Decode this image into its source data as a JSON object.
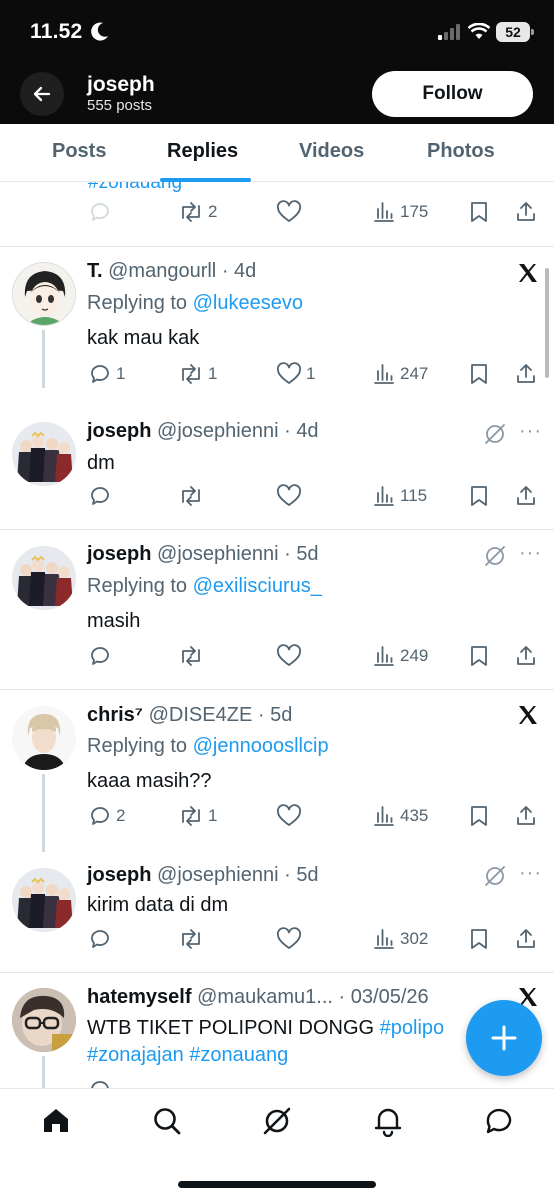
{
  "status_bar": {
    "time": "11.52",
    "battery": "52"
  },
  "profile": {
    "name": "joseph",
    "posts": "555 posts",
    "follow_label": "Follow"
  },
  "tabs": [
    {
      "label": "Posts"
    },
    {
      "label": "Replies"
    },
    {
      "label": "Videos"
    },
    {
      "label": "Photos"
    }
  ],
  "partial_post": {
    "hashtag": "#zonauang",
    "retweets": "2",
    "views": "175"
  },
  "posts": [
    {
      "name": "T.",
      "handle": "@mangourll",
      "time": "4d",
      "replying_prefix": "Replying to",
      "replying_to": "@lukeesevo",
      "text": "kak mau kak",
      "replies": "1",
      "retweets": "1",
      "likes": "1",
      "views": "247",
      "badge": "x-icon"
    },
    {
      "name": "joseph",
      "handle": "@josephienni",
      "time": "4d",
      "text": "dm",
      "views": "115",
      "badge": "grok-icon"
    },
    {
      "name": "joseph",
      "handle": "@josephienni",
      "time": "5d",
      "replying_prefix": "Replying to",
      "replying_to": "@exilisciurus_",
      "text": "masih",
      "views": "249",
      "badge": "grok-icon"
    },
    {
      "name": "chris⁷",
      "handle": "@DISE4ZE",
      "time": "5d",
      "replying_prefix": "Replying to",
      "replying_to": "@jennooosllcip",
      "text": "kaaa masih??",
      "replies": "2",
      "retweets": "1",
      "views": "435",
      "badge": "x-icon"
    },
    {
      "name": "joseph",
      "handle": "@josephienni",
      "time": "5d",
      "text": "kirim data di dm",
      "views": "302",
      "badge": "grok-icon"
    },
    {
      "name": "hatemyself",
      "handle": "@maukamu1...",
      "time": "03/05/26",
      "text": "WTB TIKET POLIPONI DONGG",
      "hashtag_inline": "#polipo",
      "hashtags_line2": "#zonajajan #zonauang",
      "badge": "x-icon"
    }
  ],
  "separator": "·",
  "colors": {
    "accent": "#1d9bf0",
    "text": "#0f1419",
    "muted": "#536471",
    "header_bg": "#0b0b0b"
  },
  "bottom_nav": [
    "home-icon",
    "search-icon",
    "grok-icon",
    "notifications-icon",
    "messages-icon"
  ]
}
